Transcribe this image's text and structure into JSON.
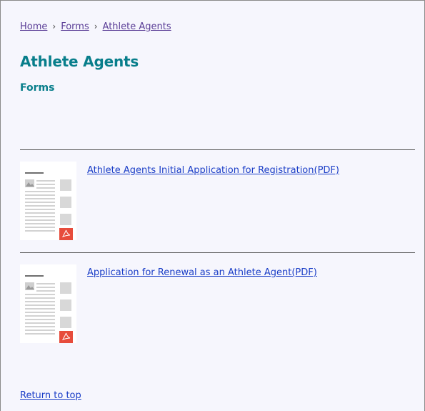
{
  "breadcrumb": {
    "items": [
      {
        "label": "Home"
      },
      {
        "label": "Forms"
      },
      {
        "label": "Athlete Agents"
      }
    ],
    "separator": "›"
  },
  "page": {
    "title": "Athlete Agents",
    "section_title": "Forms"
  },
  "documents": [
    {
      "label": "Athlete Agents Initial Application for Registration(PDF)",
      "thumbnail_icon": "pdf-document-icon"
    },
    {
      "label": "Application for Renewal as an Athlete Agent(PDF)",
      "thumbnail_icon": "pdf-document-icon"
    }
  ],
  "footer": {
    "return_to_top": "Return to top"
  },
  "colors": {
    "heading": "#087e8b",
    "link": "#1b3ec7",
    "breadcrumb_link": "#5a3d96",
    "pdf_badge": "#e74c3c",
    "background": "#f6f6fd"
  }
}
